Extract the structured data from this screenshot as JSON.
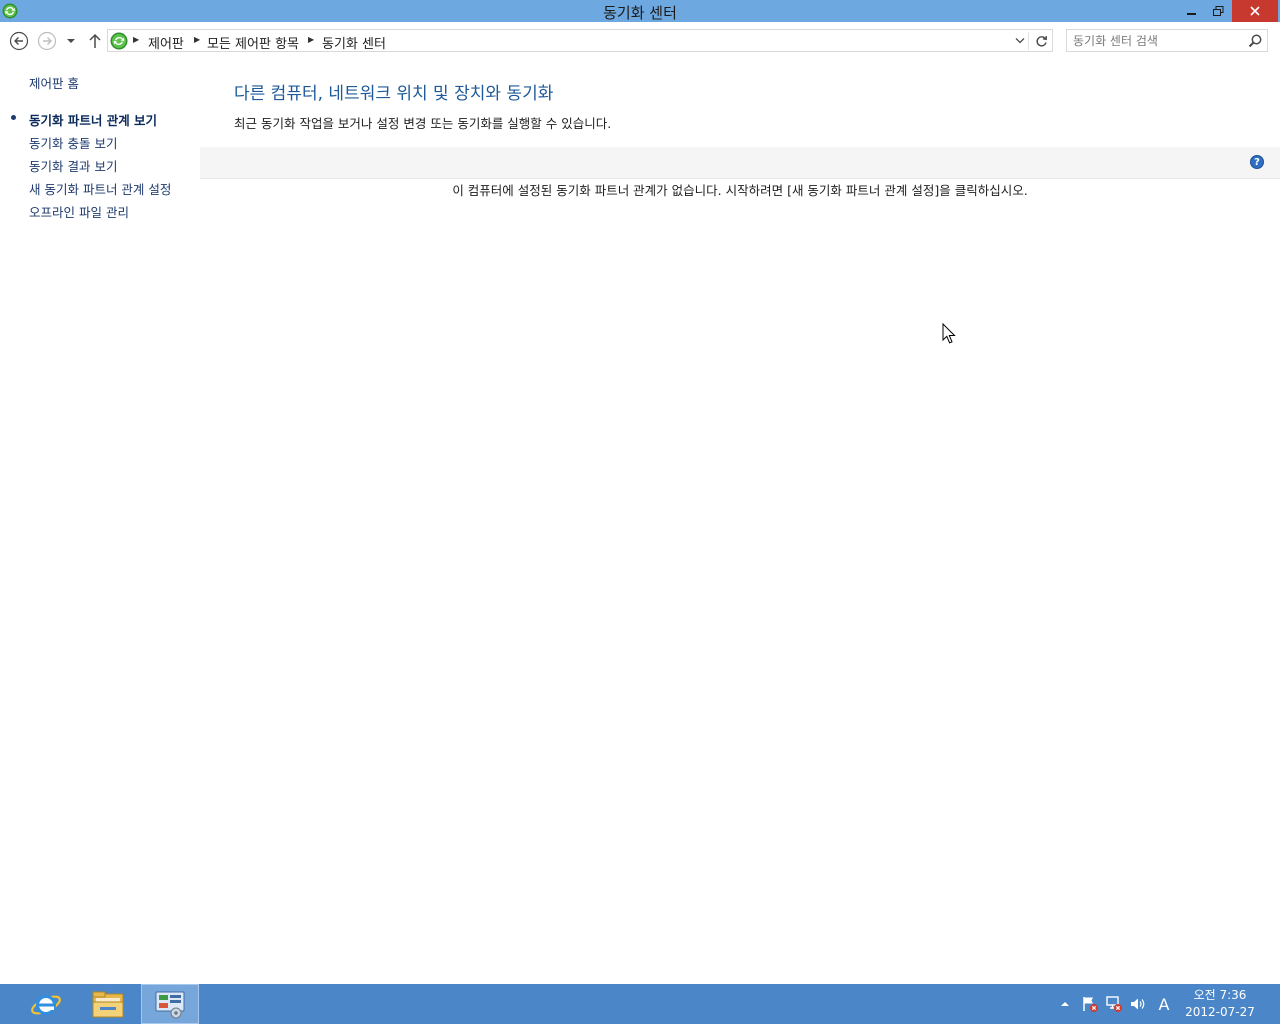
{
  "window": {
    "title": "동기화 센터",
    "min_label": "🗕",
    "restore_label": "🗗",
    "close_label": "✕"
  },
  "address": {
    "crumbs": [
      "제어판",
      "모든 제어판 항목",
      "동기화 센터"
    ]
  },
  "search": {
    "placeholder": "동기화 센터 검색"
  },
  "sidebar": {
    "home": "제어판 홈",
    "items": [
      {
        "label": "동기화 파트너 관계 보기",
        "active": true
      },
      {
        "label": "동기화 충돌 보기",
        "active": false
      },
      {
        "label": "동기화 결과 보기",
        "active": false
      },
      {
        "label": "새 동기화 파트너 관계 설정",
        "active": false
      },
      {
        "label": "오프라인 파일 관리",
        "active": false
      }
    ]
  },
  "main": {
    "heading": "다른 컴퓨터, 네트워크 위치 및 장치와 동기화",
    "subtext": "최근 동기화 작업을 보거나 설정 변경 또는 동기화를 실행할 수 있습니다.",
    "help_label": "?",
    "empty_message": "이 컴퓨터에 설정된 동기화 파트너 관계가 없습니다. 시작하려면 [새 동기화 파트너 관계 설정]을 클릭하십시오."
  },
  "taskbar": {
    "apps": [
      "internet-explorer",
      "file-explorer",
      "control-panel"
    ],
    "ime_label": "A",
    "clock_time": "오전 7:36",
    "clock_date": "2012-07-27"
  },
  "colors": {
    "titlebar": "#6ea8e0",
    "close_button": "#c7392f",
    "link": "#1e3a6e",
    "heading": "#1e5a9a",
    "taskbar": "#4a86c8"
  }
}
